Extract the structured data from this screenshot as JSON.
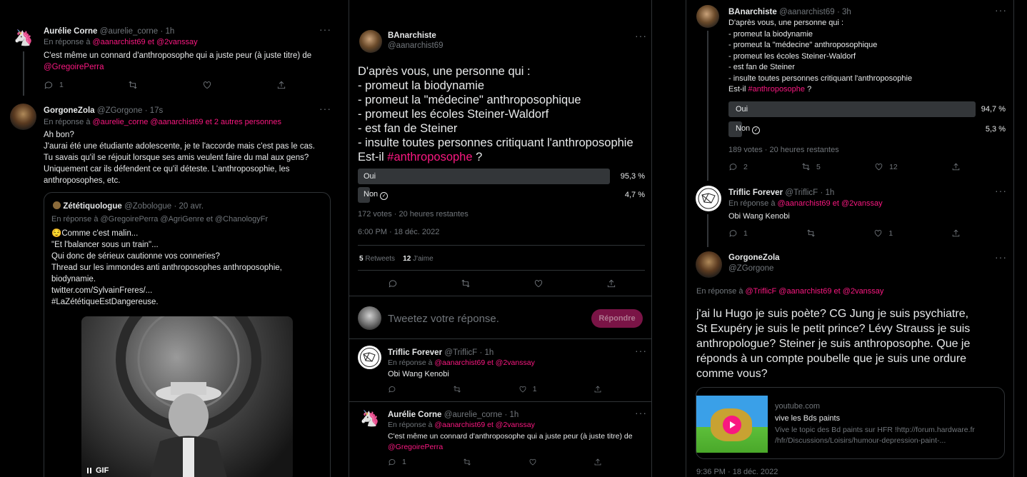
{
  "col1": {
    "tweet1": {
      "name": "Aurélie Corne",
      "handle": "@aurelie_corne",
      "time": "· 1h",
      "reply_prefix": "En réponse à",
      "reply_to": "@aanarchist69",
      "reply_sep": "et",
      "reply_to2": "@2vanssay",
      "text": "C'est même un connard d'anthroposophe qui a juste peur (à juste titre) de",
      "text_mention": "@GregoirePerra",
      "reply_count": "1",
      "more": "···"
    },
    "tweet2": {
      "name": "GorgoneZola",
      "handle": "@ZGorgone",
      "time": "· 17s",
      "reply_prefix": "En réponse à",
      "reply_to": "@aurelie_corne @aanarchist69",
      "reply_sep": "et 2 autres personnes",
      "lines": [
        "Ah bon?",
        "J'aurai été une étudiante adolescente, je te l'accorde mais c'est pas le cas.",
        "Tu savais qu'il se réjouit lorsque ses amis veulent faire du mal aux gens?",
        "Uniquement car ils défendent ce qu'il déteste. L'anthroposophie, les",
        "anthroposophes, etc."
      ],
      "more": "···"
    },
    "quote": {
      "name": "Zététiquologue",
      "handle": "@Zobologue",
      "time": "· 20 avr.",
      "reply_line": "En réponse à @GregoirePerra @AgriGenre  et  @ChanologyFr",
      "lines": [
        "😌Comme c'est malin...",
        " \"Et l'balancer sous un train\"...",
        "Qui donc de sérieux cautionne vos conneries?",
        "Thread sur les immondes anti anthroposophes anthroposophie,",
        "biodynamie.",
        "twitter.com/SylvainFreres/...",
        "#LaZététiqueEstDangereuse."
      ],
      "gif_label": "GIF"
    }
  },
  "col2": {
    "main": {
      "name": "BAnarchiste",
      "handle": "@aanarchist69",
      "more": "···",
      "lines": [
        "D'après vous, une personne qui :",
        "- promeut la biodynamie",
        "- promeut la \"médecine\" anthroposophique",
        "- promeut les écoles Steiner-Waldorf",
        "- est fan de Steiner",
        "- insulte toutes personnes critiquant l'anthroposophie"
      ],
      "last_prefix": "Est-il",
      "hashtag": "#anthroposophe",
      "last_suffix": "?",
      "poll": [
        {
          "label": "Oui",
          "pct": "95,3 %",
          "value": 95.3
        },
        {
          "label": "Non",
          "pct": "4,7 %",
          "value": 4.7
        }
      ],
      "poll_meta": "172 votes · 20 heures restantes",
      "timestamp": "6:00 PM · 18 déc. 2022",
      "retweets_n": "5",
      "retweets_label": "Retweets",
      "likes_n": "12",
      "likes_label": "J'aime"
    },
    "compose": {
      "placeholder": "Tweetez votre réponse.",
      "button": "Répondre"
    },
    "reply1": {
      "name": "Triflic Forever",
      "handle": "@TriflicF",
      "time": "· 1h",
      "reply_prefix": "En réponse à",
      "reply_to": "@aanarchist69",
      "reply_sep": "et",
      "reply_to2": "@2vanssay",
      "text": "Obi Wang Kenobi",
      "like_count": "1",
      "more": "···"
    },
    "reply2": {
      "name": "Aurélie Corne",
      "handle": "@aurelie_corne",
      "time": "· 1h",
      "reply_prefix": "En réponse à",
      "reply_to": "@aanarchist69",
      "reply_sep": "et",
      "reply_to2": "@2vanssay",
      "text": "C'est même un connard d'anthroposophe qui a juste peur (à juste titre) de",
      "text_mention": "@GregoirePerra",
      "reply_count": "1",
      "more": "···"
    }
  },
  "col3": {
    "tweet1": {
      "name": "BAnarchiste",
      "handle": "@aanarchist69",
      "time": "· 3h",
      "more": "···",
      "lines": [
        "D'après vous, une personne qui :",
        "- promeut la biodynamie",
        "- promeut la \"médecine\" anthroposophique",
        "- promeut les écoles Steiner-Waldorf",
        "- est fan de Steiner",
        "- insulte toutes personnes critiquant l'anthroposophie"
      ],
      "last_prefix": "Est-il",
      "hashtag": "#anthroposophe",
      "last_suffix": "?",
      "poll": [
        {
          "label": "Oui",
          "pct": "94,7 %",
          "value": 94.7
        },
        {
          "label": "Non",
          "pct": "5,3 %",
          "value": 5.3
        }
      ],
      "poll_meta": "189 votes · 20 heures restantes",
      "reply_count": "2",
      "rt_count": "5",
      "like_count": "12"
    },
    "tweet2": {
      "name": "Triflic Forever",
      "handle": "@TriflicF",
      "time": "· 1h",
      "more": "···",
      "reply_prefix": "En réponse à",
      "reply_to": "@aanarchist69",
      "reply_sep": "et",
      "reply_to2": "@2vanssay",
      "text": "Obi Wang Kenobi",
      "reply_count": "1",
      "like_count": "1"
    },
    "tweet3": {
      "name": "GorgoneZola",
      "handle": "@ZGorgone",
      "more": "···",
      "reply_prefix": "En réponse à",
      "reply_to": "@TriflicF @aanarchist69",
      "reply_sep": "et",
      "reply_to2": "@2vanssay",
      "lines": [
        "j'ai lu Hugo je suis poète? CG Jung je suis psychiatre,",
        "St Exupéry je suis le petit prince? Lévy Strauss je suis",
        "anthropologue? Steiner je suis anthroposophe. Que je",
        "réponds à un compte poubelle que je suis une ordure",
        "comme vous?"
      ],
      "card": {
        "domain": "youtube.com",
        "title": "vive les Bds paints",
        "desc1": "Vive le topic des Bd paints sur HFR !http://forum.hardware.fr",
        "desc2": "/hfr/Discussions/Loisirs/humour-depression-paint-..."
      },
      "timestamp": "9:36 PM · 18 déc. 2022"
    }
  }
}
